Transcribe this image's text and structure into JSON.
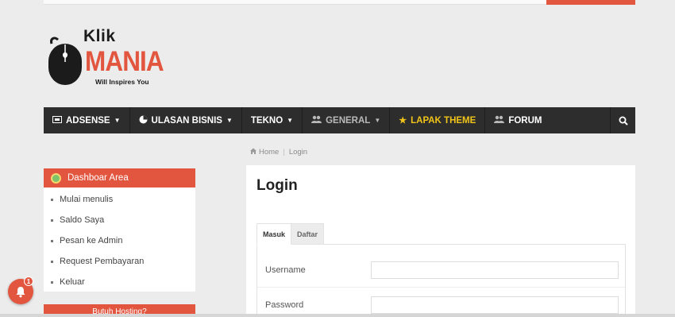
{
  "logo": {
    "line1": "Klik",
    "line2": "MANIA",
    "tagline": "Will Inspires You"
  },
  "nav": {
    "items": [
      {
        "label": "ADSENSE",
        "icon": "ad-icon",
        "caret": true,
        "style": "normal"
      },
      {
        "label": "ULASAN BISNIS",
        "icon": "pie-chart-icon",
        "caret": true,
        "style": "normal"
      },
      {
        "label": "TEKNO",
        "icon": "",
        "caret": true,
        "style": "normal"
      },
      {
        "label": "GENERAL",
        "icon": "users-icon",
        "caret": true,
        "style": "muted"
      },
      {
        "label": "LAPAK THEME",
        "icon": "star-icon",
        "caret": false,
        "style": "gold"
      },
      {
        "label": "FORUM",
        "icon": "users-icon",
        "caret": false,
        "style": "normal"
      }
    ],
    "search_icon": "search-icon"
  },
  "breadcrumb": {
    "home": "Home",
    "current": "Login"
  },
  "sidebar": {
    "title": "Dashboar Area",
    "items": [
      {
        "label": "Mulai menulis"
      },
      {
        "label": "Saldo Saya"
      },
      {
        "label": "Pesan ke Admin"
      },
      {
        "label": "Request Pembayaran"
      },
      {
        "label": "Keluar"
      }
    ],
    "second_title": "Butuh Hosting?"
  },
  "main": {
    "title": "Login",
    "tabs": [
      {
        "label": "Masuk",
        "active": true
      },
      {
        "label": "Daftar",
        "active": false
      }
    ],
    "fields": {
      "username_label": "Username",
      "username_value": "",
      "password_label": "Password",
      "password_value": ""
    }
  },
  "notification": {
    "count": "1"
  },
  "colors": {
    "accent": "#e2553e",
    "nav_bg": "#2d2d2d",
    "gold": "#f0c419",
    "page_bg": "#ececec"
  }
}
